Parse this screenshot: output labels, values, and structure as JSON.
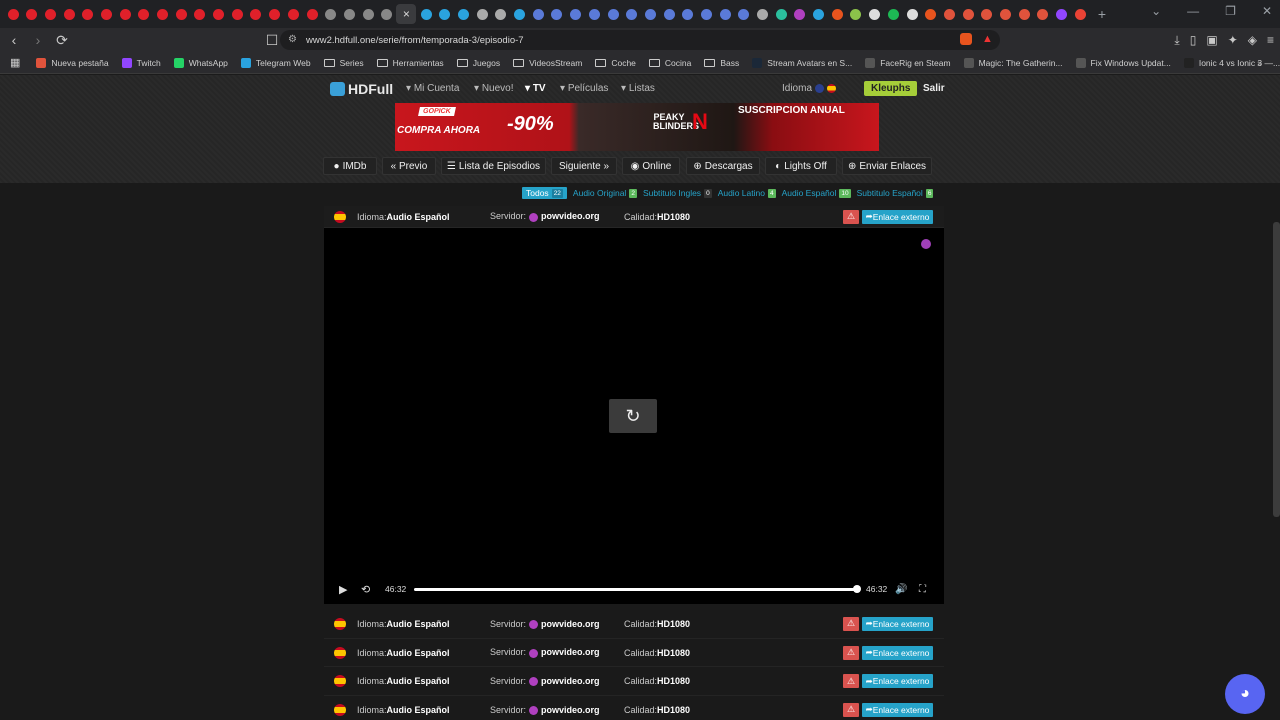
{
  "browser": {
    "tab_count_shown": 59,
    "active_tab_close": "×",
    "new_tab": "+",
    "url": "www2.hdfull.one/serie/from/temporada-3/episodio-7"
  },
  "bookmarks": [
    {
      "label": "Nueva pestaña",
      "color": "#e0533c"
    },
    {
      "label": "Twitch",
      "color": "#9146ff"
    },
    {
      "label": "WhatsApp",
      "color": "#25d366"
    },
    {
      "label": "Telegram Web",
      "color": "#2aa3df"
    },
    {
      "label": "Series",
      "folder": true
    },
    {
      "label": "Herramientas",
      "folder": true
    },
    {
      "label": "Juegos",
      "folder": true
    },
    {
      "label": "VideosStream",
      "folder": true
    },
    {
      "label": "Coche",
      "folder": true
    },
    {
      "label": "Cocina",
      "folder": true
    },
    {
      "label": "Bass",
      "folder": true
    },
    {
      "label": "Stream Avatars en S...",
      "color": "#1b2838"
    },
    {
      "label": "FaceRig en Steam",
      "color": "#555"
    },
    {
      "label": "Magic: The Gatherin...",
      "color": "#555"
    },
    {
      "label": "Fix Windows Updat...",
      "color": "#555"
    },
    {
      "label": "Ionic 4 vs Ionic 3 —...",
      "color": "#222"
    }
  ],
  "site": {
    "logo": "HDFull",
    "nav": {
      "mi_cuenta": "Mi Cuenta",
      "nuevo": "Nuevo!",
      "tv": "TV",
      "peliculas": "Películas",
      "listas": "Listas",
      "idioma": "Idioma",
      "user": "Kleuphs",
      "salir": "Salir"
    },
    "banner": {
      "gopick": "GOPICK",
      "compra": "COMPRA AHORA",
      "discount": "-90%",
      "peaky": "PEAKY BLINDERS",
      "netflix": "N",
      "suscripcion": "SUSCRIPCION ANUAL"
    },
    "toolbar": {
      "imdb": "IMDb",
      "previo": "« Previo",
      "lista": "Lista de Episodios",
      "siguiente": "Siguiente »",
      "online": "Online",
      "descargas": "Descargas",
      "lights": "Lights Off",
      "enviar": "Enviar Enlaces"
    },
    "filters": [
      {
        "label": "Todos",
        "count": "22",
        "active": true,
        "count_color": "#26a3c9"
      },
      {
        "label": "Audio Original",
        "count": "2",
        "count_color": "#5cb85c"
      },
      {
        "label": "Subtitulo Ingles",
        "count": "0",
        "count_color": "#333"
      },
      {
        "label": "Audio Latino",
        "count": "4",
        "count_color": "#5cb85c"
      },
      {
        "label": "Audio Español",
        "count": "10",
        "count_color": "#5cb85c"
      },
      {
        "label": "Subtitulo Español",
        "count": "6",
        "count_color": "#5cb85c"
      }
    ],
    "link_row": {
      "idioma_label": "Idioma:",
      "idioma_value": "Audio Español",
      "servidor_label": "Servidor:",
      "servidor_value": "powvideo.org",
      "calidad_label": "Calidad:",
      "calidad_value": "HD1080",
      "warn": "⚠",
      "external": "Enlace externo"
    },
    "player": {
      "time_current": "46:32",
      "time_total": "46:32",
      "progress": 1.0
    }
  }
}
